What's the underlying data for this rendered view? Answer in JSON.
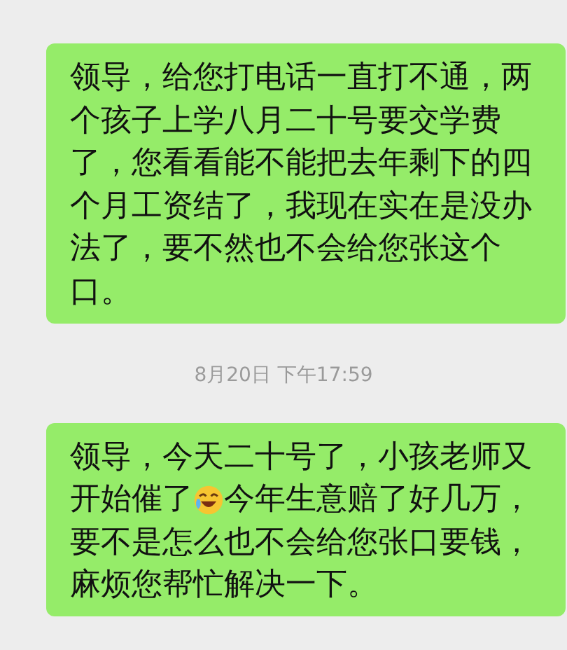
{
  "messages": [
    {
      "kind": "bubble",
      "lines": [
        [
          {
            "kind": "text",
            "text": "领导，给您打电话一直打不通，两个孩子上学八月二十号要交学费了，您看看能不能把去年剩下的四个月工资结了，我现在实在是没办法了，要不然也不会给您张这个口。"
          }
        ]
      ]
    },
    {
      "kind": "time",
      "text": "8月20日 下午17:59"
    },
    {
      "kind": "bubble",
      "lines": [
        [
          {
            "kind": "text",
            "text": "领导，今天二十号了，小孩老师又"
          }
        ],
        [
          {
            "kind": "text",
            "text": "开始催了"
          },
          {
            "kind": "emoji"
          },
          {
            "kind": "text",
            "text": "今年生意赔了好几万，"
          }
        ],
        [
          {
            "kind": "text",
            "text": "要不是怎么也不会给您张口要钱，麻烦您帮忙解决一下。"
          }
        ]
      ]
    }
  ]
}
